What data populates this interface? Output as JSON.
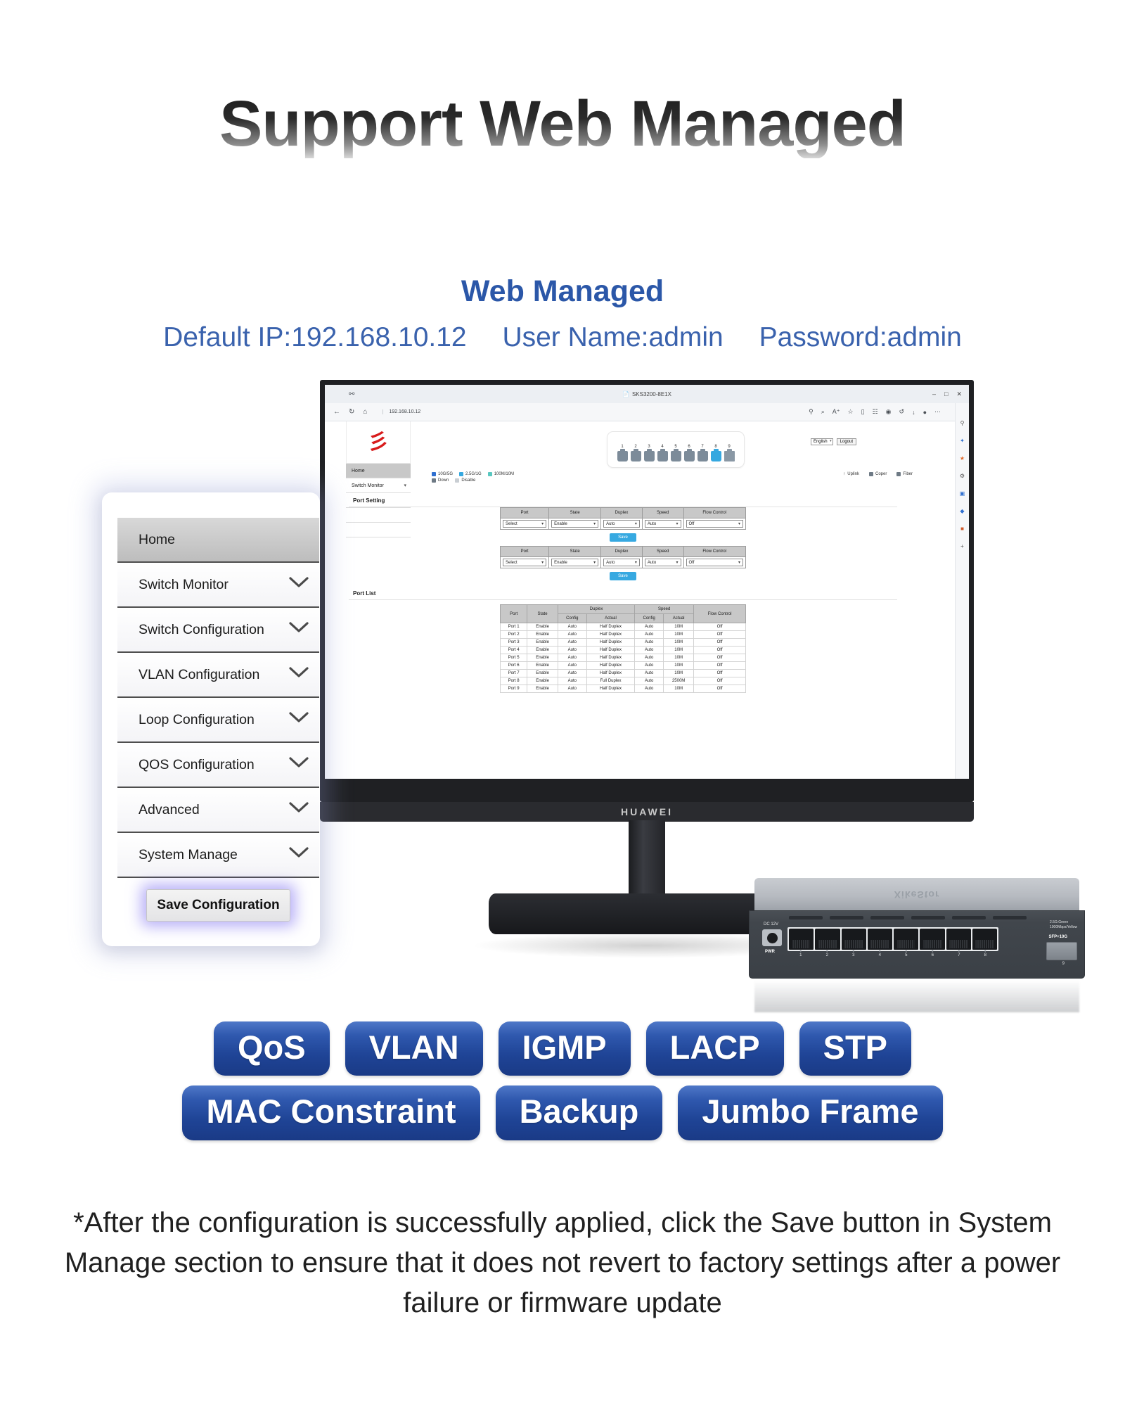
{
  "header": {
    "title": "Support Web Managed",
    "subtitle": "Web Managed",
    "default_ip": "Default IP:192.168.10.12",
    "user_name": "User Name:admin",
    "password": "Password:admin"
  },
  "browser": {
    "tab_title": "SKS3200-8E1X",
    "url": "192.168.10.12",
    "shield_icon": "shield-icon",
    "back_icon": "back-arrow-icon",
    "reload_icon": "reload-icon",
    "home_icon": "home-icon",
    "minimize": "–",
    "maximize": "□",
    "close": "✕",
    "tools": [
      "search-icon",
      "zoom-icon",
      "read-aloud-icon",
      "favorite-icon",
      "split-screen-icon",
      "collections-icon",
      "browser-essentials-icon",
      "history-icon",
      "downloads-icon",
      "profile-icon",
      "more-icon",
      "sidebar-icon"
    ],
    "side_icons": [
      "search-icon",
      "copilot-icon",
      "shopping-icon",
      "settings-icon",
      "collections-icon",
      "games-icon",
      "drop-icon",
      "add-icon"
    ]
  },
  "webapp": {
    "logo_mark": "彡",
    "nav_items": [
      {
        "label": "Home",
        "active": true,
        "chevron": ""
      },
      {
        "label": "Switch Monitor",
        "active": false,
        "chevron": "∨"
      }
    ],
    "lang_value": "English",
    "logout_label": "Logout",
    "ports": [
      {
        "num": "1",
        "state": "down"
      },
      {
        "num": "2",
        "state": "down"
      },
      {
        "num": "3",
        "state": "down"
      },
      {
        "num": "4",
        "state": "down"
      },
      {
        "num": "5",
        "state": "down"
      },
      {
        "num": "6",
        "state": "down"
      },
      {
        "num": "7",
        "state": "down"
      },
      {
        "num": "8",
        "state": "active"
      },
      {
        "num": "9",
        "state": "sfp"
      }
    ],
    "legend": {
      "speed_items": [
        {
          "label": "10G/5G",
          "color": "#2f6fd0"
        },
        {
          "label": "2.5G/1G",
          "color": "#35a8e0"
        },
        {
          "label": "100M/10M",
          "color": "#59c7c0"
        }
      ],
      "status_items": [
        {
          "label": "Down",
          "color": "#6e7a85"
        },
        {
          "label": "Disable",
          "color": "#c9ced3"
        }
      ],
      "uplink_label": "Uplink",
      "coper_label": "Coper",
      "fiber_label": "Fiber"
    },
    "section_setting": "Port Setting",
    "section_list": "Port List",
    "setting_table": {
      "headers": [
        "Port",
        "State",
        "Duplex",
        "Speed",
        "Flow Control"
      ],
      "values": [
        "Select",
        "Enable",
        "Auto",
        "Auto",
        "Off"
      ],
      "save_label": "Save"
    },
    "list_table": {
      "group_headers": [
        "Port",
        "State",
        "Duplex",
        "Speed",
        "Flow Control"
      ],
      "sub_headers": [
        "Config",
        "Actual",
        "Config",
        "Actual"
      ],
      "rows": [
        [
          "Port 1",
          "Enable",
          "Auto",
          "Half Duplex",
          "Auto",
          "10M",
          "Off"
        ],
        [
          "Port 2",
          "Enable",
          "Auto",
          "Half Duplex",
          "Auto",
          "10M",
          "Off"
        ],
        [
          "Port 3",
          "Enable",
          "Auto",
          "Half Duplex",
          "Auto",
          "10M",
          "Off"
        ],
        [
          "Port 4",
          "Enable",
          "Auto",
          "Half Duplex",
          "Auto",
          "10M",
          "Off"
        ],
        [
          "Port 5",
          "Enable",
          "Auto",
          "Half Duplex",
          "Auto",
          "10M",
          "Off"
        ],
        [
          "Port 6",
          "Enable",
          "Auto",
          "Half Duplex",
          "Auto",
          "10M",
          "Off"
        ],
        [
          "Port 7",
          "Enable",
          "Auto",
          "Half Duplex",
          "Auto",
          "10M",
          "Off"
        ],
        [
          "Port 8",
          "Enable",
          "Auto",
          "Full Duplex",
          "Auto",
          "2500M",
          "Off"
        ],
        [
          "Port 9",
          "Enable",
          "Auto",
          "Half Duplex",
          "Auto",
          "10M",
          "Off"
        ]
      ]
    }
  },
  "menu_card": {
    "items": [
      {
        "label": "Home",
        "chevron": "",
        "active": true
      },
      {
        "label": "Switch Monitor",
        "chevron": "chevron-down-icon",
        "active": false
      },
      {
        "label": "Switch Configuration",
        "chevron": "chevron-down-icon",
        "active": false
      },
      {
        "label": "VLAN Configuration",
        "chevron": "chevron-down-icon",
        "active": false
      },
      {
        "label": "Loop Configuration",
        "chevron": "chevron-down-icon",
        "active": false
      },
      {
        "label": "QOS Configuration",
        "chevron": "chevron-down-icon",
        "active": false
      },
      {
        "label": "Advanced",
        "chevron": "chevron-down-icon",
        "active": false
      },
      {
        "label": "System Manage",
        "chevron": "chevron-down-icon",
        "active": false
      }
    ],
    "save_configuration_label": "Save Configuration"
  },
  "monitor": {
    "brand": "HUAWEI"
  },
  "device": {
    "brand": "XikeStor",
    "dc_label": "DC 12V",
    "pwr_label": "PWR",
    "led_legend_line1": "2.5G:Green",
    "led_legend_line2": "1000Mbps/Yellow",
    "sfp_label": "SFP+10G",
    "port_numbers": [
      "1",
      "2",
      "3",
      "4",
      "5",
      "6",
      "7",
      "8"
    ],
    "sfp_number": "9"
  },
  "badges": {
    "row1": [
      "QoS",
      "VLAN",
      "IGMP",
      "LACP",
      "STP"
    ],
    "row2": [
      "MAC Constraint",
      "Backup",
      "Jumbo Frame"
    ],
    "color": "#1f4496"
  },
  "footnote": {
    "text": "*After the configuration is successfully applied, click the Save button in System Manage section to ensure that it does not revert to factory settings after a power failure or firmware update"
  }
}
